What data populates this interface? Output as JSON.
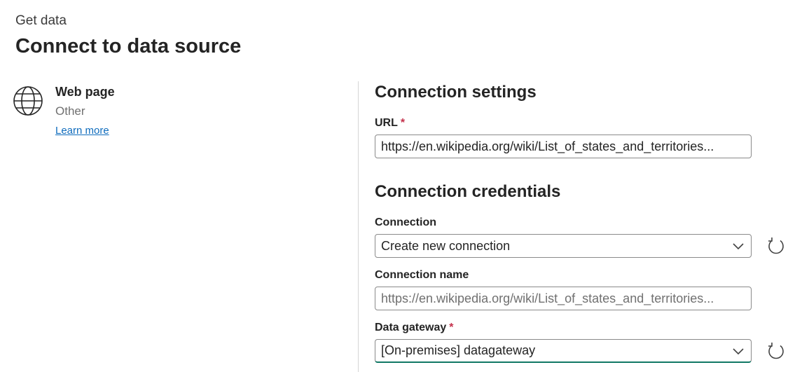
{
  "header": {
    "breadcrumb": "Get data",
    "title": "Connect to data source"
  },
  "source": {
    "name": "Web page",
    "category": "Other",
    "learn_more": "Learn more",
    "icon": "globe-icon"
  },
  "settings": {
    "heading": "Connection settings",
    "url_label": "URL",
    "url_required": "*",
    "url_value": "https://en.wikipedia.org/wiki/List_of_states_and_territories..."
  },
  "credentials": {
    "heading": "Connection credentials",
    "connection_label": "Connection",
    "connection_value": "Create new connection",
    "connection_name_label": "Connection name",
    "connection_name_value": "https://en.wikipedia.org/wiki/List_of_states_and_territories...",
    "gateway_label": "Data gateway",
    "gateway_required": "*",
    "gateway_value": "[On-premises] datagateway"
  },
  "colors": {
    "link": "#0f6cbd",
    "required": "#c4314b",
    "focus_underline": "#117865"
  }
}
